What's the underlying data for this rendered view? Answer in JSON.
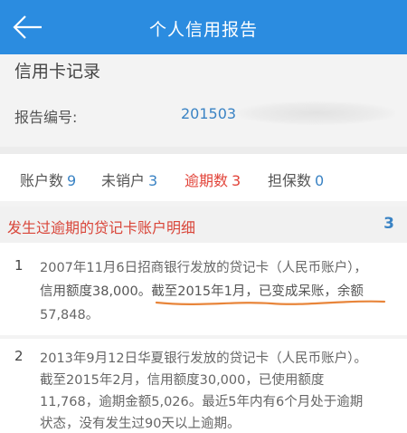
{
  "header": {
    "title": "个人信用报告"
  },
  "section": {
    "title": "信用卡记录"
  },
  "report": {
    "label": "报告编号:",
    "value": "201503"
  },
  "stats": [
    {
      "label": "账户数",
      "count": "9"
    },
    {
      "label": "未销户",
      "count": "3"
    },
    {
      "label": "逾期数",
      "count": "3"
    },
    {
      "label": "担保数",
      "count": "0"
    }
  ],
  "detail": {
    "title": "发生过逾期的贷记卡账户明细",
    "count": "3",
    "items": [
      {
        "index": "1",
        "lines": [
          "2007年11月6日招商银行发放的贷记卡（人民币账户），",
          "信用额度38,000。截至2015年1月，已变成呆账，余额",
          "57,848。"
        ]
      },
      {
        "index": "2",
        "lines": [
          "2013年9月12日华夏银行发放的贷记卡（人民币账户）。",
          "截至2015年2月，信用额度30,000，已使用额度",
          "11,768，逾期金额5,026。最近5年内有6个月处于逾期",
          "状态，没有发生过90天以上逾期。"
        ]
      }
    ]
  },
  "colors": {
    "header": "#2b8ce0",
    "accent_blue": "#3a83c4",
    "accent_red": "#d9463a",
    "annotation": "#e8853a"
  }
}
